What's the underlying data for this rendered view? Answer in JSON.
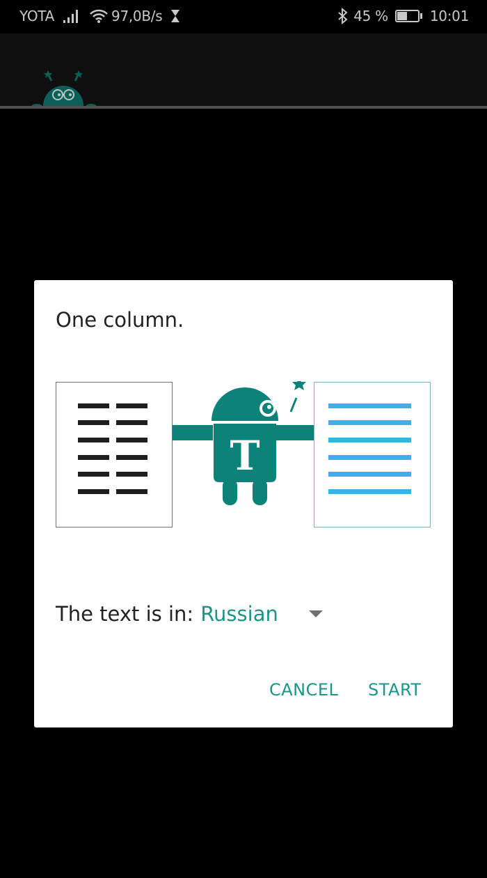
{
  "status_bar": {
    "carrier": "YOTA",
    "network_speed": "97,0B/s",
    "battery_percent": "45 %",
    "battery_level": 0.45,
    "time": "10:01",
    "icons": [
      "signal-icon",
      "wifi-icon",
      "hourglass-icon",
      "bluetooth-icon",
      "battery-icon"
    ]
  },
  "app_bar": {
    "logo": "robot-mascot-icon"
  },
  "dialog": {
    "title": "One column.",
    "illustration": {
      "left": "two-column-page-icon",
      "center": "robot-t-mascot-icon",
      "right": "one-column-page-icon"
    },
    "language_label": "The text is in:",
    "language_value": "Russian",
    "buttons": {
      "cancel": "CANCEL",
      "start": "START"
    }
  },
  "colors": {
    "accent": "#1a9688",
    "mascot": "#0b8378",
    "page_lines_dark": "#1e1e1e",
    "page_lines_blue": "#3cb1e4"
  }
}
